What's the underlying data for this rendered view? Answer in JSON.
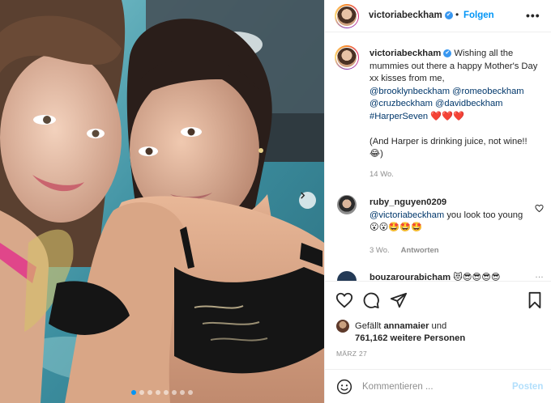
{
  "post": {
    "username": "victoriabeckham",
    "follow_label": "Folgen",
    "separator": "•",
    "more_label": "•••",
    "verified_mark": "✔",
    "photo": {
      "description_icon": "selfie-photo",
      "carousel_slides": 8,
      "active_slide": 1
    }
  },
  "caption": {
    "username": "victoriabeckham",
    "verified_mark": "✔",
    "text_intro": "Wishing all the mummies out there a happy Mother's Day xx kisses from me,",
    "mentions": [
      "@brooklynbeckham",
      "@romeobeckham",
      "@cruzbeckham",
      "@davidbeckham",
      "#HarperSeven"
    ],
    "hearts": "❤️❤️❤️",
    "text_note": "(And Harper is drinking juice, not wine!! 😂)",
    "age": "14 Wo."
  },
  "comments": [
    {
      "username": "ruby_nguyen0209",
      "mention": "@victoriabeckham",
      "text": "you look too young 😮😮🤩🤩🤩",
      "age": "3 Wo.",
      "reply_label": "Antworten"
    },
    {
      "username": "bouzarourabicham",
      "text": "😻😎😎😎😎",
      "more_label": "…"
    }
  ],
  "likes": {
    "prefix": "Gefällt",
    "first_user": "annamaier",
    "connector": "und",
    "count_text": "761,162 weitere Personen"
  },
  "date": "MÄRZ 27",
  "composer": {
    "placeholder": "Kommentieren ...",
    "post_label": "Posten"
  },
  "colors": {
    "accent": "#0095f6",
    "mention": "#00376b",
    "muted": "#8e8e8e",
    "heart": "#ed4956",
    "post_disabled": "#b2dffc"
  },
  "icons": [
    "heart-icon",
    "comment-icon",
    "share-icon",
    "bookmark-icon",
    "emoji-icon",
    "chevron-right-icon",
    "more-icon",
    "verified-icon"
  ]
}
